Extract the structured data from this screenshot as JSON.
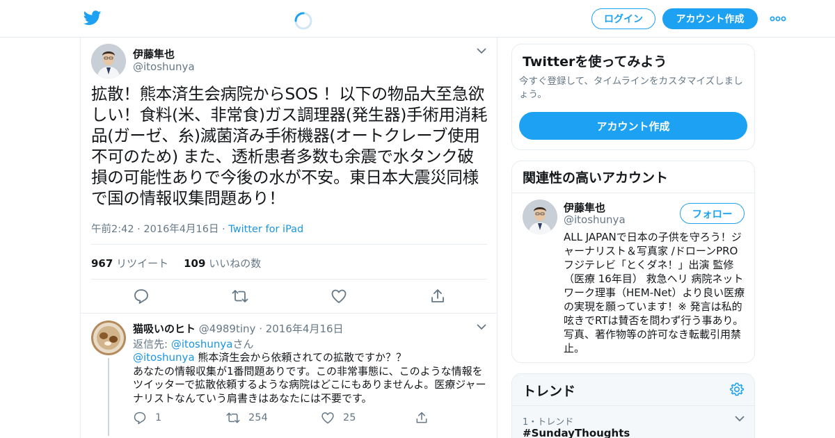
{
  "header": {
    "login_label": "ログイン",
    "signup_label": "アカウント作成",
    "brand_color": "#1da1f2"
  },
  "tweet": {
    "name": "伊藤隼也",
    "handle": "@itoshunya",
    "text": "拡散！熊本済生会病院からSOS ！以下の物品大至急欲しい！食料(米、非常食)ガス調理器(発生器)手術用消耗品(ガーゼ、糸)滅菌済み手術機器(オートクレーブ使用不可のため) また、透析患者多数も余震で水タンク破損の可能性ありで今後の水が不安。東日本大震災同様で国の情報収集問題あり！",
    "time": "午前2:42 · 2016年4月16日 ·",
    "source": "Twitter for iPad",
    "retweet_count": "967",
    "retweet_label": "リツイート",
    "like_count": "109",
    "like_label": "いいねの数"
  },
  "reply": {
    "name": "猫吸いのヒト",
    "handle": "@4989tiny",
    "date": "· 2016年4月16日",
    "reply_to_prefix": "返信先: ",
    "reply_to_mention": "@itoshunya",
    "reply_to_suffix": "さん",
    "mention": "@itoshunya",
    "text_first": " 熊本済生会から依頼されての拡散ですか？？",
    "text_rest": "あなたの情報収集が1番問題ありです。この非常事態に、このような情報をツイッターで拡散依頼するような病院はどこにもありませんよ。医療ジャーナリストなんていう肩書きはあなたには不要です。",
    "reply_count": "1",
    "retweet_count": "254",
    "like_count": "25"
  },
  "signup_card": {
    "title": "Twitterを使ってみよう",
    "description": "今すぐ登録して、タイムラインをカスタマイズしましょう。",
    "button_label": "アカウント作成"
  },
  "related_card": {
    "title": "関連性の高いアカウント",
    "name": "伊藤隼也",
    "handle": "@itoshunya",
    "follow_label": "フォロー",
    "bio": "ALL JAPANで日本の子供を守ろう！ジャーナリスト＆写真家 /ドローンPRO フジテレビ「とくダネ！」出演 監修（医療 16年目） 救急ヘリ 病院ネットワーク理事（HEM-Net）より良い医療の実現を願っています！※ 発言は私的呟きでRTは賛否を問わず行う事あり。写真、著作物等の許可なき転載引用禁止。"
  },
  "trends_card": {
    "title": "トレンド",
    "item_meta": "1・トレンド",
    "item_tag": "#SundayThoughts"
  },
  "icons": [
    "twitter-bird-icon",
    "loading-spinner-icon",
    "more-icon",
    "chevron-down-icon",
    "reply-icon",
    "retweet-icon",
    "like-icon",
    "share-icon",
    "gear-icon"
  ]
}
